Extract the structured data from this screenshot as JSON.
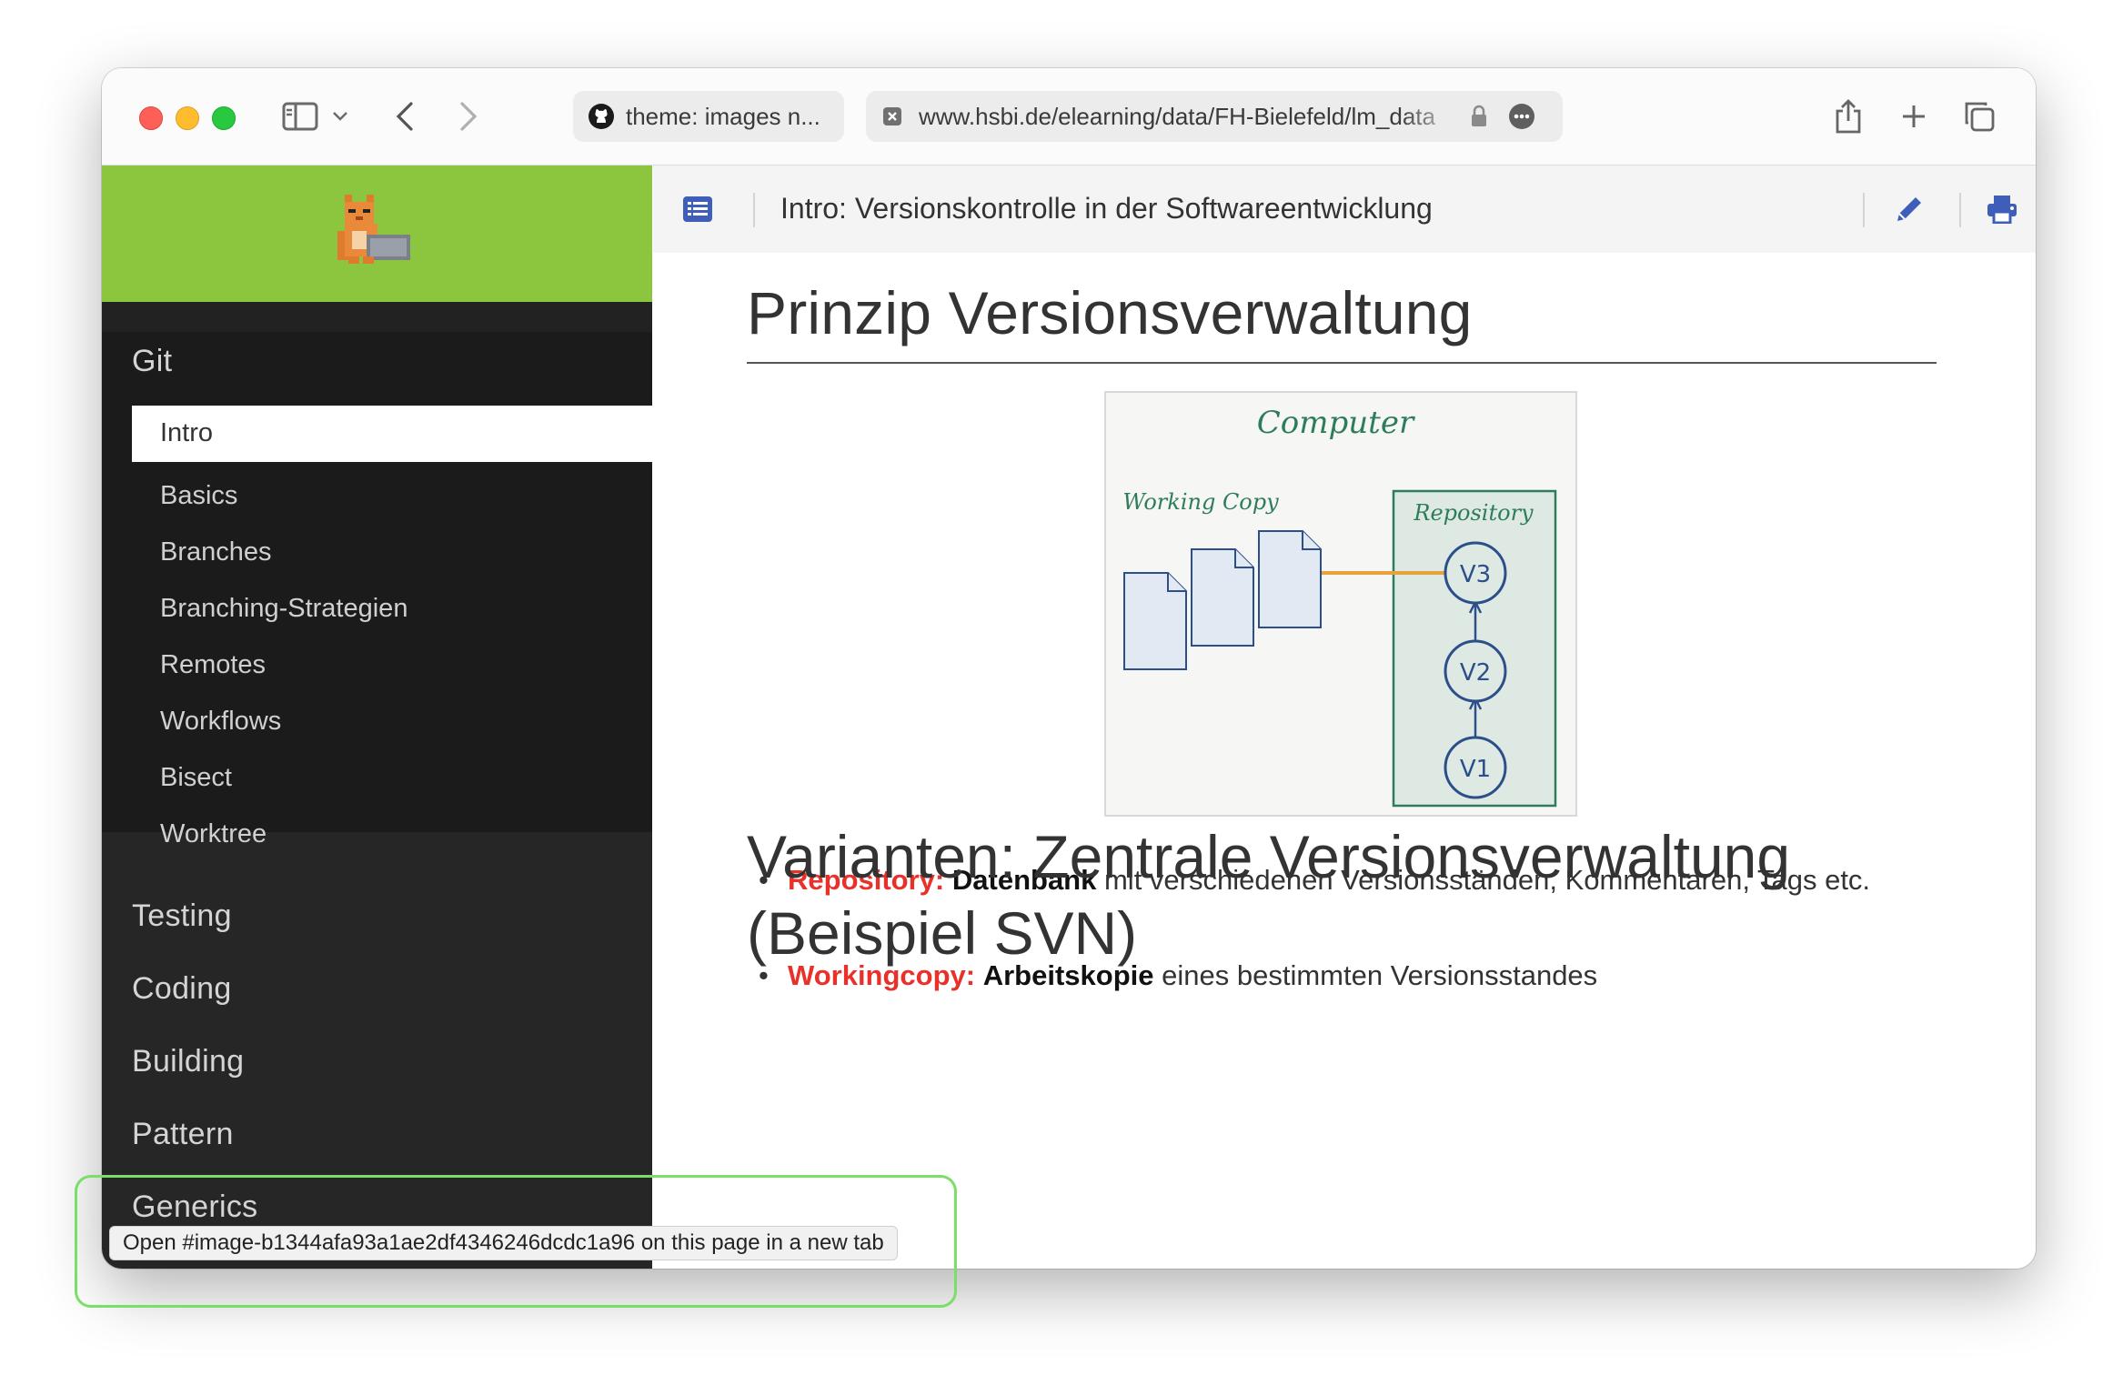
{
  "browser": {
    "tab_title": "theme: images n...",
    "url": "www.hsbi.de/elearning/data/FH-Bielefeld/lm_data"
  },
  "header": {
    "title": "Intro: Versionskontrolle in der Softwareentwicklung"
  },
  "sidebar": {
    "section_git": "Git",
    "git_items": [
      "Intro",
      "Basics",
      "Branches",
      "Branching-Strategien",
      "Remotes",
      "Workflows",
      "Bisect",
      "Worktree"
    ],
    "sections": [
      "Testing",
      "Coding",
      "Building",
      "Pattern",
      "Generics"
    ]
  },
  "main": {
    "heading": "Prinzip Versionsverwaltung",
    "figure": {
      "title": "Computer",
      "working_copy": "Working Copy",
      "repository": "Repository",
      "v3": "V3",
      "v2": "V2",
      "v1": "V1"
    },
    "bullets": [
      {
        "term": "Repository:",
        "bold": "Datenbank",
        "rest": "mit verschiedenen Versionsständen, Kommentaren, Tags etc."
      },
      {
        "term": "Workingcopy:",
        "bold": "Arbeitskopie",
        "rest": "eines bestimmten Versionsstandes"
      }
    ],
    "heading2": "Varianten: Zentrale Versionsverwaltung (Beispiel SVN)"
  },
  "status": {
    "link_hint": "Open #image-b1344afa93a1ae2df4346246dcdc1a96 on this page in a new tab"
  },
  "colors": {
    "sidebar_green": "#8cc63e",
    "accent_blue": "#3f5eba",
    "term_red": "#e9312a",
    "figure_green": "#2e7d5a",
    "figure_blue": "#2c4f8a",
    "connector_orange": "#e8a23c"
  }
}
